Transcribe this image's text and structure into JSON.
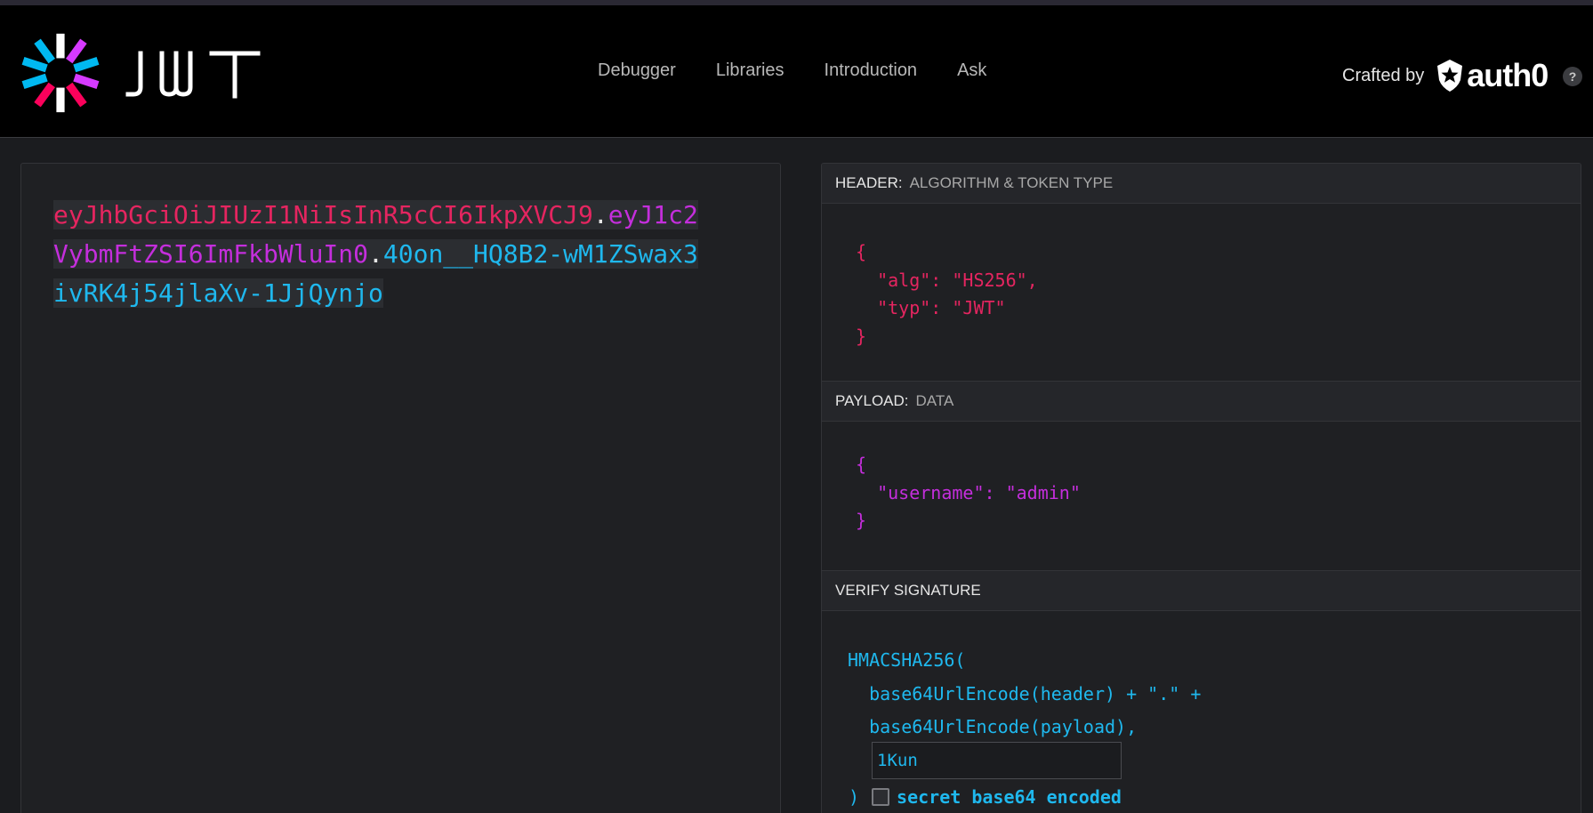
{
  "nav": {
    "items": [
      "Debugger",
      "Libraries",
      "Introduction",
      "Ask"
    ],
    "crafted_label": "Crafted by",
    "brand_name": "auth0",
    "help_label": "?"
  },
  "encoded": {
    "header_part": "eyJhbGciOiJIUzI1NiIsInR5cCI6IkpXVCJ9",
    "payload_part": "eyJ1c2VybmFtZSI6ImFkbWluIn0",
    "signature_part": "40on__HQ8B2-wM1ZSwax3ivRK4j54jlaXv-1JjQynjo",
    "dot": "."
  },
  "decoded": {
    "header": {
      "title": "HEADER:",
      "subtitle": "ALGORITHM & TOKEN TYPE",
      "lines": [
        "{",
        "  \"alg\": \"HS256\",",
        "  \"typ\": \"JWT\"",
        "}"
      ]
    },
    "payload": {
      "title": "PAYLOAD:",
      "subtitle": "DATA",
      "lines": [
        "{",
        "  \"username\": \"admin\"",
        "}"
      ]
    },
    "verify": {
      "title": "VERIFY SIGNATURE",
      "lines": [
        "HMACSHA256(",
        "  base64UrlEncode(header) + \".\" +",
        "  base64UrlEncode(payload),"
      ],
      "secret_value": "1Kun",
      "close_paren": ")",
      "checkbox_label": "secret base64 encoded"
    }
  },
  "colors": {
    "header": "#e52560",
    "payload": "#c42edc",
    "signature": "#1fb8ee"
  }
}
